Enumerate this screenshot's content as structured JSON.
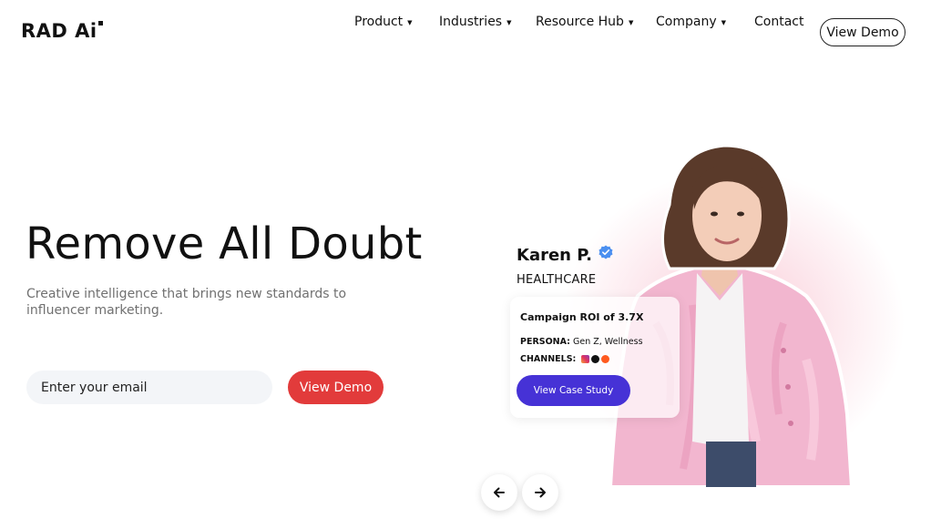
{
  "header": {
    "logo_text": "RAD Ai",
    "nav": [
      {
        "label": "Product",
        "has_dropdown": true
      },
      {
        "label": "Industries",
        "has_dropdown": true
      },
      {
        "label": "Resource Hub",
        "has_dropdown": true
      },
      {
        "label": "Company",
        "has_dropdown": true
      },
      {
        "label": "Contact",
        "has_dropdown": false
      }
    ],
    "demo_button": "View Demo"
  },
  "hero": {
    "title": "Remove All Doubt",
    "subtitle": "Creative intelligence that brings new standards to influencer marketing.",
    "email_placeholder": "Enter your email",
    "cta_button": "View Demo"
  },
  "profile": {
    "name": "Karen P.",
    "sector": "HEALTHCARE",
    "verified_icon": "verified-badge-icon",
    "card": {
      "title": "Campaign ROI of 3.7X",
      "persona_label": "PERSONA:",
      "persona_value": "Gen Z, Wellness",
      "channels_label": "CHANNELS:",
      "channel_icons": [
        "instagram-icon",
        "tiktok-icon",
        "reddit-icon"
      ],
      "button": "View Case Study"
    }
  },
  "carousel": {
    "prev_icon": "arrow-left-icon",
    "next_icon": "arrow-right-icon"
  },
  "colors": {
    "primary_red": "#e23b3b",
    "case_study_blue": "#4632d6",
    "verified_blue": "#4b8ff0",
    "input_bg": "#f3f5f8"
  }
}
